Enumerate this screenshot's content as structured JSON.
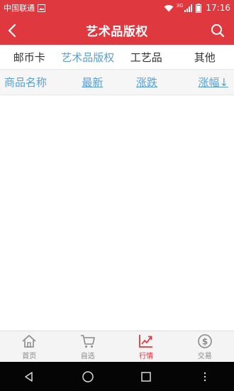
{
  "status_bar": {
    "carrier": "中国联通",
    "network": "3G",
    "time": "17:16"
  },
  "header": {
    "title": "艺术品版权",
    "back_icon": "chevron-left-icon",
    "search_icon": "search-icon",
    "background_color": "#e0383f"
  },
  "category_tabs": [
    {
      "label": "邮币卡",
      "active": false
    },
    {
      "label": "艺术品版权",
      "active": true
    },
    {
      "label": "工艺品",
      "active": false
    },
    {
      "label": "其他",
      "active": false
    }
  ],
  "list_header": {
    "name_label": "商品名称",
    "latest_label": "最新",
    "change_label": "涨跌",
    "change_pct_label": "涨幅↓"
  },
  "bottom_nav": [
    {
      "label": "首页",
      "icon": "home-icon",
      "active": false
    },
    {
      "label": "自选",
      "icon": "cart-icon",
      "active": false
    },
    {
      "label": "行情",
      "icon": "trend-icon",
      "active": true
    },
    {
      "label": "交易",
      "icon": "dollar-coin-icon",
      "active": false
    }
  ],
  "colors": {
    "accent": "#e0383f",
    "link": "#5aa0d8"
  }
}
